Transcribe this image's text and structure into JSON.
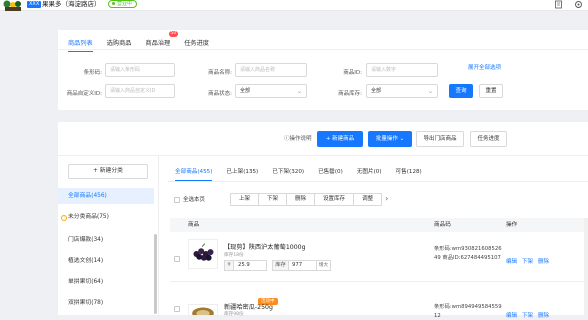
{
  "topbar": {
    "shop_tag": "XXX",
    "shop_name": "果果多（海淀路店）",
    "status": "营业中"
  },
  "filter": {
    "tabs": [
      {
        "label": "商品列表"
      },
      {
        "label": "选购商品"
      },
      {
        "label": "商品治理",
        "badge": "50"
      },
      {
        "label": "任务进度"
      }
    ],
    "fields": {
      "barcode_label": "条形码:",
      "barcode_ph": "请输入条形码",
      "name_label": "商品名称:",
      "name_ph": "请输入商品名称",
      "id_label": "商品ID:",
      "id_ph": "请输入数字",
      "custom_id_label": "商品自定义ID:",
      "custom_id_ph": "请输入商品自定义ID",
      "status_label": "商品状态:",
      "status_value": "全部",
      "stock_label": "商品库存:",
      "stock_value": "全部"
    },
    "expand_label": "展开全部选项",
    "query_label": "查询",
    "reset_label": "重置"
  },
  "toolbar": {
    "help_label": "操作说明",
    "new_product_label": "+ 新建商品",
    "batch_label": "批量操作",
    "export_label": "导出门店商品",
    "task_label": "任务进度"
  },
  "sidebar": {
    "new_category_label": "+ 新建分类",
    "items": [
      {
        "label": "全部商品(456)"
      },
      {
        "label": "未分类商品(75)"
      },
      {
        "label": "门店爆款(34)"
      },
      {
        "label": "植选文创(14)"
      },
      {
        "label": "单拼果切(64)"
      },
      {
        "label": "双拼果切(78)"
      }
    ]
  },
  "subtabs": [
    {
      "label": "全部商品(455)"
    },
    {
      "label": "已上架(135)"
    },
    {
      "label": "已下架(320)"
    },
    {
      "label": "已售罄(0)"
    },
    {
      "label": "无图片(0)"
    },
    {
      "label": "可售(128)"
    }
  ],
  "bulk": {
    "select_all": "全选本页",
    "buttons": [
      "上架",
      "下架",
      "删除",
      "设置库存",
      "调整"
    ]
  },
  "table": {
    "headers": {
      "product": "商品",
      "code": "商品码",
      "ops": "操作"
    },
    "rows": [
      {
        "title": "【现剪】陕西沪太葡萄1000g",
        "stock_note": "库存18份",
        "currency": "¥",
        "price": "25.9",
        "stock_label": "库存",
        "stock": "977",
        "more": "增大",
        "code": "条形码:wm930821608526 49 商品ID:627484495107",
        "ops": [
          "编辑",
          "下架",
          "删除"
        ]
      },
      {
        "promo": "活动中",
        "title": "新疆哈密瓜-250g",
        "stock_note": "库存98份",
        "code": "条形码:wm894949584559 12",
        "ops": [
          "编辑",
          "下架",
          "删除"
        ]
      }
    ]
  }
}
